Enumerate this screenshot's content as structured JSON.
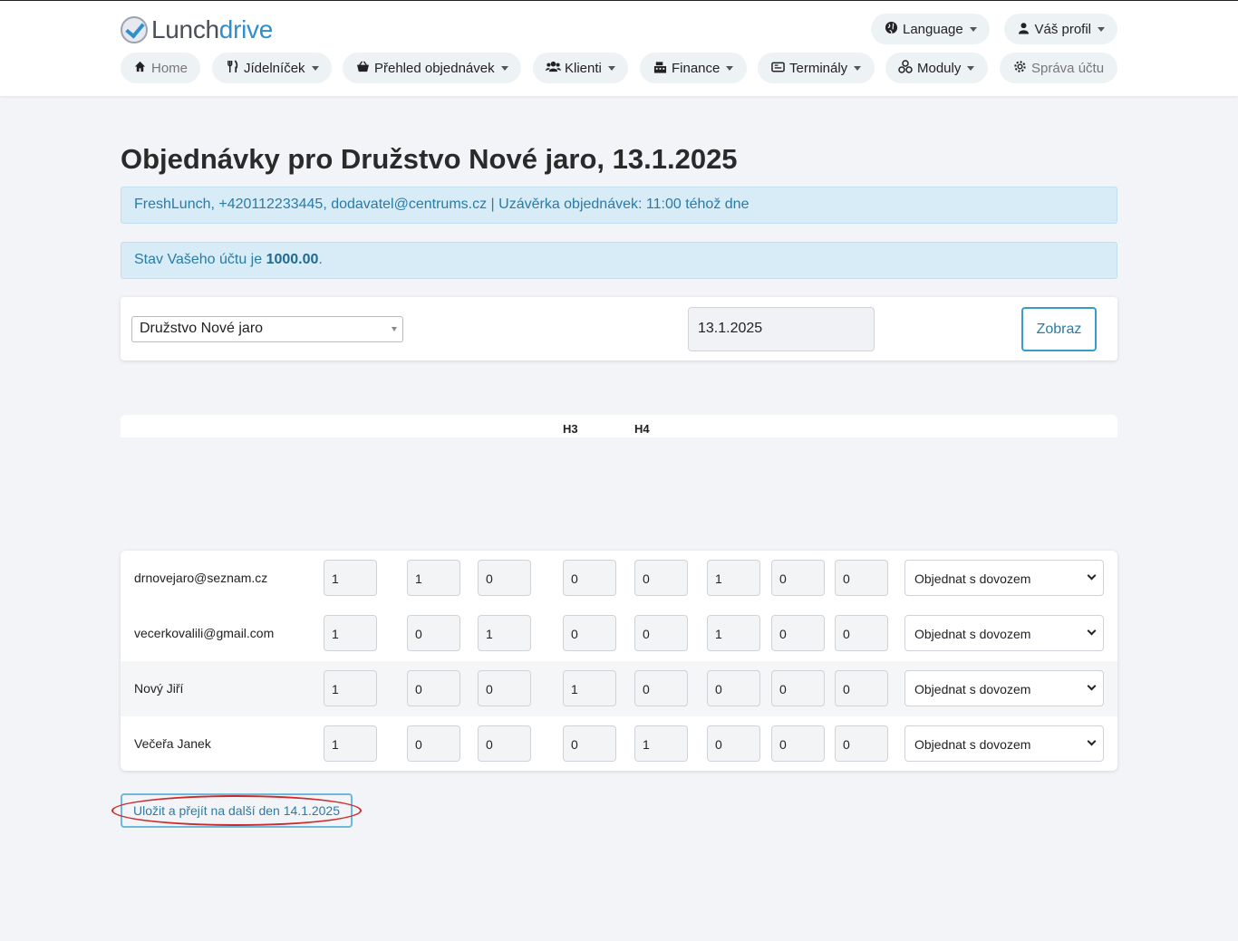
{
  "brand": {
    "part1": "Lunch",
    "part2": "drive"
  },
  "header": {
    "language": "Language",
    "profile": "Váš profil"
  },
  "nav": {
    "home": "Home",
    "menu": "Jídelníček",
    "orders": "Přehled objednávek",
    "clients": "Klienti",
    "finance": "Finance",
    "terminals": "Terminály",
    "modules": "Moduly",
    "account": "Správa účtu"
  },
  "page": {
    "title": "Objednávky pro Družstvo Nové jaro, 13.1.2025",
    "supplier_info": "FreshLunch, +420112233445, dodavatel@centrums.cz | Uzávěrka objednávek: 11:00 téhož dne",
    "balance_prefix": "Stav Vašeho účtu je ",
    "balance_value": "1000.00",
    "balance_suffix": "."
  },
  "filter": {
    "client": "Družstvo Nové jaro",
    "date": "13.1.2025",
    "show_label": "Zobraz"
  },
  "columns": {
    "h3": "H3",
    "h4": "H4"
  },
  "orders": [
    {
      "name": "drnovejaro@seznam.cz",
      "qty": [
        "1",
        "1",
        "0",
        "0",
        "0",
        "1",
        "0",
        "0"
      ],
      "mode": "Objednat s dovozem"
    },
    {
      "name": "vecerkovalili@gmail.com",
      "qty": [
        "1",
        "0",
        "1",
        "0",
        "0",
        "1",
        "0",
        "0"
      ],
      "mode": "Objednat s dovozem"
    },
    {
      "name": "Nový Jiří",
      "qty": [
        "1",
        "0",
        "0",
        "1",
        "0",
        "0",
        "0",
        "0"
      ],
      "mode": "Objednat s dovozem"
    },
    {
      "name": "Večeřa Janek",
      "qty": [
        "1",
        "0",
        "0",
        "0",
        "1",
        "0",
        "0",
        "0"
      ],
      "mode": "Objednat s dovozem"
    }
  ],
  "actions": {
    "save_next": "Uložit a přejít na další den 14.1.2025"
  },
  "colors": {
    "accent": "#2e8fcf",
    "alert_bg": "#d7ecf6",
    "alert_text": "#2a7ba6",
    "annotation": "#cc2b2b"
  }
}
